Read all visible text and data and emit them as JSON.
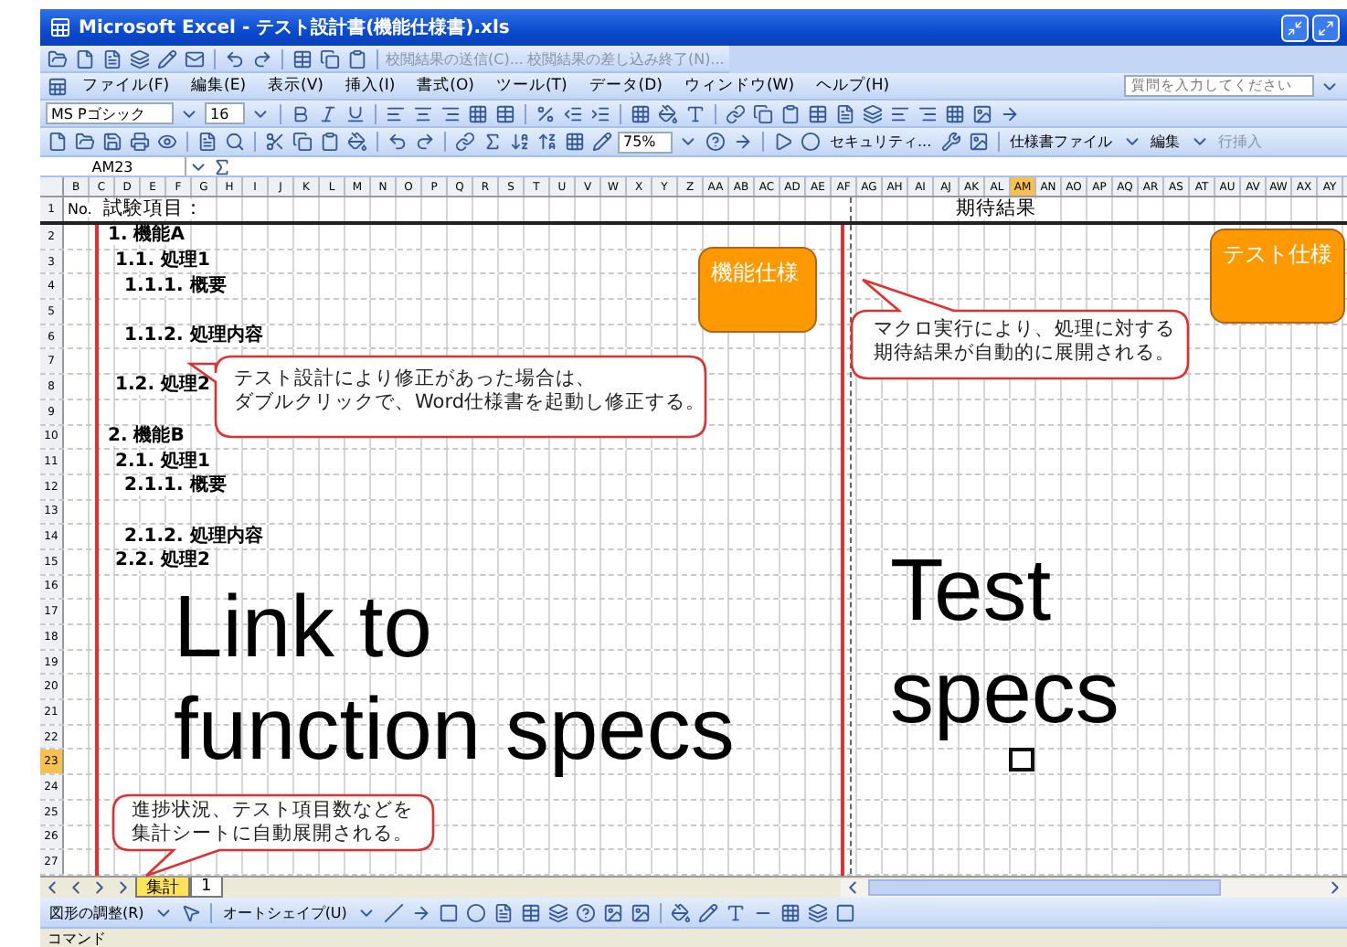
{
  "window": {
    "title": "Microsoft Excel - テスト設計書(機能仕様書).xls"
  },
  "review_toolbar": {
    "items": [
      "校閲結果の送信(C)...",
      "校閲結果の差し込み終了(N)..."
    ]
  },
  "menu": {
    "items": [
      "ファイル(F)",
      "編集(E)",
      "表示(V)",
      "挿入(I)",
      "書式(O)",
      "ツール(T)",
      "データ(D)",
      "ウィンドウ(W)",
      "ヘルプ(H)"
    ],
    "help_search": {
      "placeholder": "質問を入力してください"
    }
  },
  "format_toolbar": {
    "font": "MS Pゴシック",
    "size": "16"
  },
  "standard_toolbar": {
    "zoom": "75%"
  },
  "macro_toolbar": {
    "items": [
      "セキュリティ..."
    ]
  },
  "custom_toolbar": {
    "items": [
      {
        "label": "仕様書ファイル",
        "kind": "menu"
      },
      {
        "label": "編集",
        "kind": "menu"
      },
      {
        "label": "行挿入",
        "kind": "button"
      }
    ]
  },
  "formula_bar": {
    "name_box": "AM23"
  },
  "columns": [
    {
      "label": "B",
      "selected": false
    },
    {
      "label": "C",
      "selected": false
    },
    {
      "label": "D",
      "selected": false
    },
    {
      "label": "E",
      "selected": false
    },
    {
      "label": "F",
      "selected": false
    },
    {
      "label": "G",
      "selected": false
    },
    {
      "label": "H",
      "selected": false
    },
    {
      "label": "I",
      "selected": false
    },
    {
      "label": "J",
      "selected": false
    },
    {
      "label": "K",
      "selected": false
    },
    {
      "label": "L",
      "selected": false
    },
    {
      "label": "M",
      "selected": false
    },
    {
      "label": "N",
      "selected": false
    },
    {
      "label": "O",
      "selected": false
    },
    {
      "label": "P",
      "selected": false
    },
    {
      "label": "Q",
      "selected": false
    },
    {
      "label": "R",
      "selected": false
    },
    {
      "label": "S",
      "selected": false
    },
    {
      "label": "T",
      "selected": false
    },
    {
      "label": "U",
      "selected": false
    },
    {
      "label": "V",
      "selected": false
    },
    {
      "label": "W",
      "selected": false
    },
    {
      "label": "X",
      "selected": false
    },
    {
      "label": "Y",
      "selected": false
    },
    {
      "label": "Z",
      "selected": false
    },
    {
      "label": "AA",
      "selected": false
    },
    {
      "label": "AB",
      "selected": false
    },
    {
      "label": "AC",
      "selected": false
    },
    {
      "label": "AD",
      "selected": false
    },
    {
      "label": "AE",
      "selected": false
    },
    {
      "label": "AF",
      "selected": false
    },
    {
      "label": "AG",
      "selected": false
    },
    {
      "label": "AH",
      "selected": false
    },
    {
      "label": "AI",
      "selected": false
    },
    {
      "label": "AJ",
      "selected": false
    },
    {
      "label": "AK",
      "selected": false
    },
    {
      "label": "AL",
      "selected": false
    },
    {
      "label": "AM",
      "selected": true
    },
    {
      "label": "AN",
      "selected": false
    },
    {
      "label": "AO",
      "selected": false
    },
    {
      "label": "AP",
      "selected": false
    },
    {
      "label": "AQ",
      "selected": false
    },
    {
      "label": "AR",
      "selected": false
    },
    {
      "label": "AS",
      "selected": false
    },
    {
      "label": "AT",
      "selected": false
    },
    {
      "label": "AU",
      "selected": false
    },
    {
      "label": "AV",
      "selected": false
    },
    {
      "label": "AW",
      "selected": false
    },
    {
      "label": "AX",
      "selected": false
    },
    {
      "label": "AY",
      "selected": false
    }
  ],
  "rows": [
    {
      "label": "1",
      "selected": false,
      "cells": [
        {
          "text": "No.",
          "kind": "number"
        },
        {
          "text": "試験項目：",
          "kind": "header"
        },
        {
          "text": "期待結果",
          "kind": "result-header"
        }
      ]
    },
    {
      "label": "2",
      "selected": false,
      "cells": [
        {
          "text": "1. 機能A",
          "kind": "h1"
        }
      ]
    },
    {
      "label": "3",
      "selected": false,
      "cells": [
        {
          "text": "1.1. 処理1",
          "kind": "h2"
        }
      ]
    },
    {
      "label": "4",
      "selected": false,
      "cells": [
        {
          "text": "1.1.1. 概要",
          "kind": "h3"
        }
      ]
    },
    {
      "label": "5",
      "selected": false,
      "cells": []
    },
    {
      "label": "6",
      "selected": false,
      "cells": [
        {
          "text": "1.1.2. 処理内容",
          "kind": "h3"
        }
      ]
    },
    {
      "label": "7",
      "selected": false,
      "cells": []
    },
    {
      "label": "8",
      "selected": false,
      "cells": [
        {
          "text": "1.2. 処理2",
          "kind": "h2"
        }
      ]
    },
    {
      "label": "9",
      "selected": false,
      "cells": []
    },
    {
      "label": "10",
      "selected": false,
      "cells": [
        {
          "text": "2. 機能B",
          "kind": "h1"
        }
      ]
    },
    {
      "label": "11",
      "selected": false,
      "cells": [
        {
          "text": "2.1. 処理1",
          "kind": "h2"
        }
      ]
    },
    {
      "label": "12",
      "selected": false,
      "cells": [
        {
          "text": "2.1.1. 概要",
          "kind": "h3"
        }
      ]
    },
    {
      "label": "13",
      "selected": false,
      "cells": []
    },
    {
      "label": "14",
      "selected": false,
      "cells": [
        {
          "text": "2.1.2. 処理内容",
          "kind": "h3"
        }
      ]
    },
    {
      "label": "15",
      "selected": false,
      "cells": [
        {
          "text": "2.2. 処理2",
          "kind": "h2"
        }
      ]
    },
    {
      "label": "16",
      "selected": false,
      "cells": []
    },
    {
      "label": "17",
      "selected": false,
      "cells": []
    },
    {
      "label": "18",
      "selected": false,
      "cells": []
    },
    {
      "label": "19",
      "selected": false,
      "cells": []
    },
    {
      "label": "20",
      "selected": false,
      "cells": []
    },
    {
      "label": "21",
      "selected": false,
      "cells": []
    },
    {
      "label": "22",
      "selected": false,
      "cells": []
    },
    {
      "label": "23",
      "selected": true,
      "cells": []
    },
    {
      "label": "24",
      "selected": false,
      "cells": []
    },
    {
      "label": "25",
      "selected": false,
      "cells": []
    },
    {
      "label": "26",
      "selected": false,
      "cells": []
    },
    {
      "label": "27",
      "selected": false,
      "cells": []
    }
  ],
  "spec_boxes": [
    "機能仕様",
    "テスト仕様"
  ],
  "callouts": [
    {
      "lines": [
        "テスト設計により修正があった場合は、",
        "ダブルクリックで、Word仕様書を起動し修正する。"
      ]
    },
    {
      "lines": [
        "マクロ実行により、処理に対する",
        "期待結果が自動的に展開される。"
      ]
    },
    {
      "lines": [
        "進捗状況、テスト項目数などを",
        "集計シートに自動展開される。"
      ]
    }
  ],
  "big_labels": [
    "Link to\nfunction specs",
    "Test\nspecs"
  ],
  "sheet_tabs": [
    {
      "label": "集計",
      "selected": true
    },
    {
      "label": "1",
      "selected": false
    }
  ],
  "drawing_toolbar": {
    "items": [
      "図形の調整(R)",
      "オートシェイプ(U)"
    ]
  },
  "status_bar": {
    "text": "コマンド"
  }
}
